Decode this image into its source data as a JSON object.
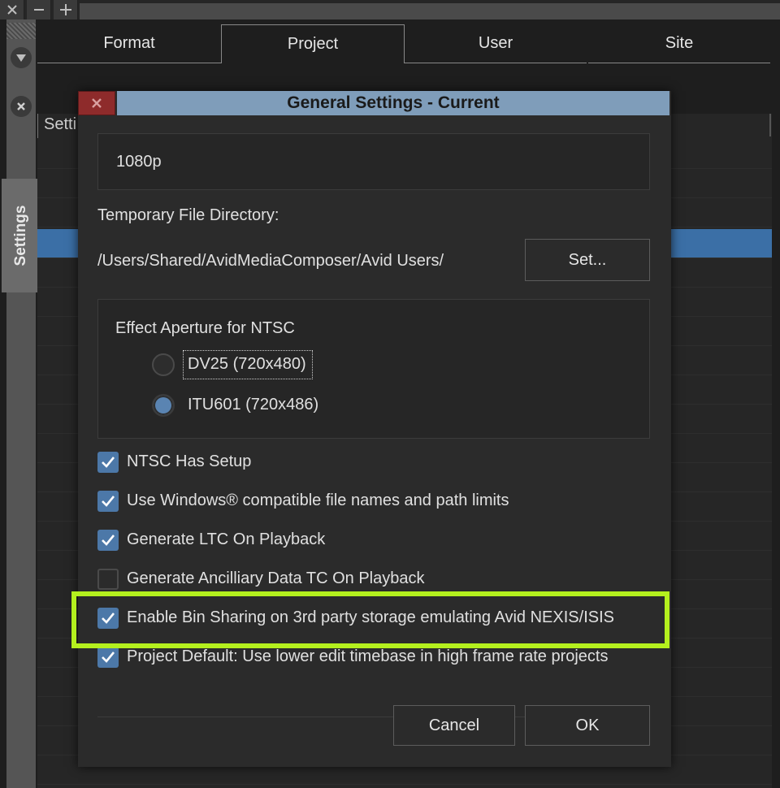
{
  "tabs": [
    {
      "label": "Format",
      "active": false
    },
    {
      "label": "Project",
      "active": true
    },
    {
      "label": "User",
      "active": false
    },
    {
      "label": "Site",
      "active": false
    }
  ],
  "side_panel": {
    "label": "Settings"
  },
  "background_list": {
    "header": "Setti"
  },
  "dialog": {
    "title": "General Settings - Current",
    "format_value": "1080p",
    "temp_dir_label": "Temporary File Directory:",
    "temp_dir_path": "/Users/Shared/AvidMediaComposer/Avid Users/",
    "set_button": "Set...",
    "aperture": {
      "label": "Effect Aperture for NTSC",
      "options": [
        {
          "label": "DV25 (720x480)",
          "selected": false
        },
        {
          "label": "ITU601 (720x486)",
          "selected": true
        }
      ]
    },
    "checkboxes": [
      {
        "label": "NTSC Has Setup",
        "checked": true
      },
      {
        "label": "Use Windows® compatible file names and path limits",
        "checked": true
      },
      {
        "label": "Generate LTC On Playback",
        "checked": true
      },
      {
        "label": "Generate Ancilliary Data TC On Playback",
        "checked": false
      },
      {
        "label": "Enable Bin Sharing on 3rd party storage emulating Avid NEXIS/ISIS",
        "checked": true,
        "highlighted": true
      },
      {
        "label": "Project Default: Use lower edit timebase in high frame rate projects",
        "checked": true
      }
    ],
    "cancel_button": "Cancel",
    "ok_button": "OK"
  },
  "colors": {
    "accent": "#4c78a8",
    "title_bar": "#7f9dba",
    "highlight": "#b4f01e",
    "close_button": "#8e2b2b"
  }
}
